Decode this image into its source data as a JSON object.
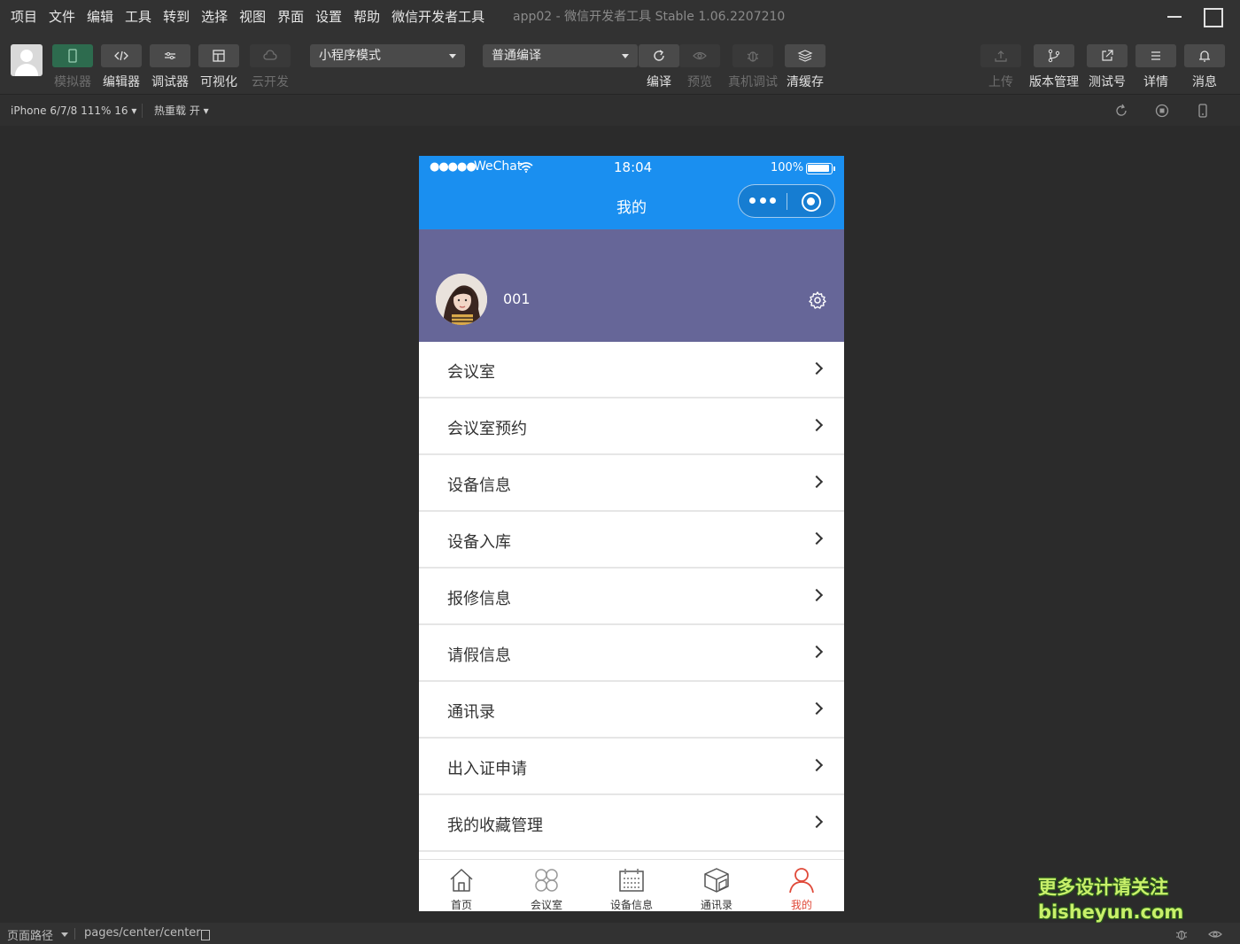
{
  "menubar": {
    "items": [
      "项目",
      "文件",
      "编辑",
      "工具",
      "转到",
      "选择",
      "视图",
      "界面",
      "设置",
      "帮助",
      "微信开发者工具"
    ],
    "app_title": "app02 - 微信开发者工具 Stable 1.06.2207210"
  },
  "toolbar": {
    "simulator": "模拟器",
    "editor": "编辑器",
    "debugger": "调试器",
    "visual": "可视化",
    "cloud": "云开发",
    "mode_select": "小程序模式",
    "compile_select": "普通编译",
    "compile": "编译",
    "preview": "预览",
    "remote_debug": "真机调试",
    "clear_cache": "清缓存",
    "upload": "上传",
    "version": "版本管理",
    "test_account": "测试号",
    "details": "详情",
    "messages": "消息"
  },
  "subbar": {
    "device": "iPhone 6/7/8 111% 16 ▾",
    "hot_reload": "热重载 开 ▾"
  },
  "phone": {
    "status": {
      "dots": "●●●●●",
      "carrier": "WeChat",
      "time": "18:04",
      "battery": "100%"
    },
    "nav_title": "我的",
    "profile_name": "001",
    "menu": [
      {
        "label": "会议室"
      },
      {
        "label": "会议室预约"
      },
      {
        "label": "设备信息"
      },
      {
        "label": "设备入库"
      },
      {
        "label": "报修信息"
      },
      {
        "label": "请假信息"
      },
      {
        "label": "通讯录"
      },
      {
        "label": "出入证申请"
      },
      {
        "label": "我的收藏管理"
      }
    ],
    "tabs": [
      {
        "label": "首页",
        "icon": "home-icon"
      },
      {
        "label": "会议室",
        "icon": "grid-icon"
      },
      {
        "label": "设备信息",
        "icon": "calendar-icon"
      },
      {
        "label": "通讯录",
        "icon": "box-icon"
      },
      {
        "label": "我的",
        "icon": "user-icon",
        "active": true
      }
    ]
  },
  "watermark": {
    "line1": "更多设计请关注",
    "line2": "bisheyun.com"
  },
  "bottombar": {
    "path_label": "页面路径",
    "path": "pages/center/center"
  },
  "colors": {
    "accent": "#1a8ff0",
    "profile_bg": "#666698",
    "active_tab": "#e04a3a"
  }
}
